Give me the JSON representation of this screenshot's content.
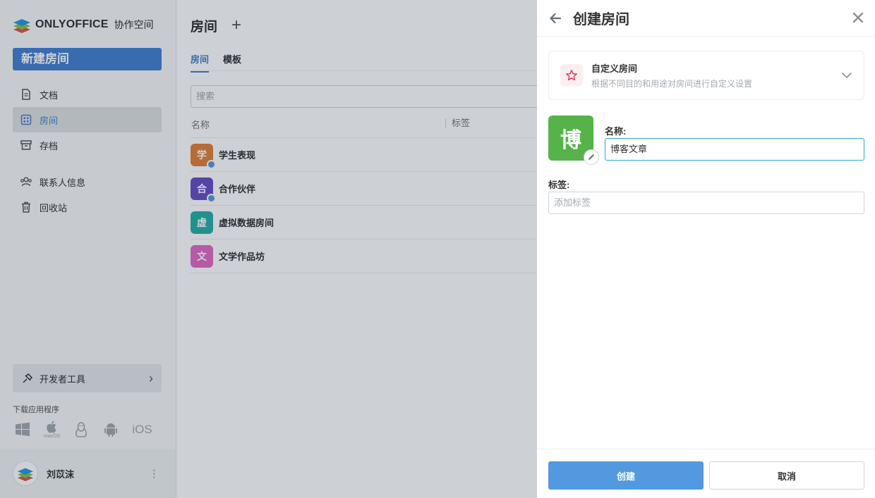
{
  "app": {
    "brand": "ONLYOFFICE",
    "brand_sub": "协作空间",
    "new_room_label": "新建房间"
  },
  "sidebar": {
    "items": [
      {
        "label": "文档",
        "icon": "document-icon"
      },
      {
        "label": "房间",
        "icon": "rooms-grid-icon",
        "active": true
      },
      {
        "label": "存档",
        "icon": "archive-icon"
      },
      {
        "label": "联系人信息",
        "icon": "contacts-icon"
      },
      {
        "label": "回收站",
        "icon": "trash-icon"
      }
    ],
    "dev_tools_label": "开发者工具",
    "download_label": "下载应用程序",
    "os": [
      "windows-icon",
      "macos-icon",
      "linux-icon",
      "android-icon",
      "iOS"
    ],
    "macos_caption": "macOS",
    "ios_label": "iOS",
    "user_name": "刘苡沫"
  },
  "main": {
    "title": "房间",
    "tabs": [
      "房间",
      "模板"
    ],
    "search_placeholder": "搜索",
    "columns": {
      "name": "名称",
      "tags": "标签"
    },
    "rooms": [
      {
        "initial": "学",
        "name": "学生表现",
        "color": "#e0823d",
        "public": true
      },
      {
        "initial": "合",
        "name": "合作伙伴",
        "color": "#6b4fc8",
        "public": true
      },
      {
        "initial": "虚",
        "name": "虚拟数据房间",
        "color": "#2bb0a8",
        "public": false
      },
      {
        "initial": "文",
        "name": "文学作品坊",
        "color": "#e36cc3",
        "public": false
      }
    ]
  },
  "panel": {
    "title": "创建房间",
    "room_type_title": "自定义房间",
    "room_type_desc": "根据不同目的和用途对房间进行自定义设置",
    "logo_char": "博",
    "name_label": "名称:",
    "name_value": "博客文章",
    "tags_label": "标签:",
    "tags_placeholder": "添加标签",
    "create_label": "创建",
    "cancel_label": "取消"
  },
  "colors": {
    "accent": "#4781d1",
    "create_button": "#5299e0",
    "room_logo": "#56b34a"
  }
}
